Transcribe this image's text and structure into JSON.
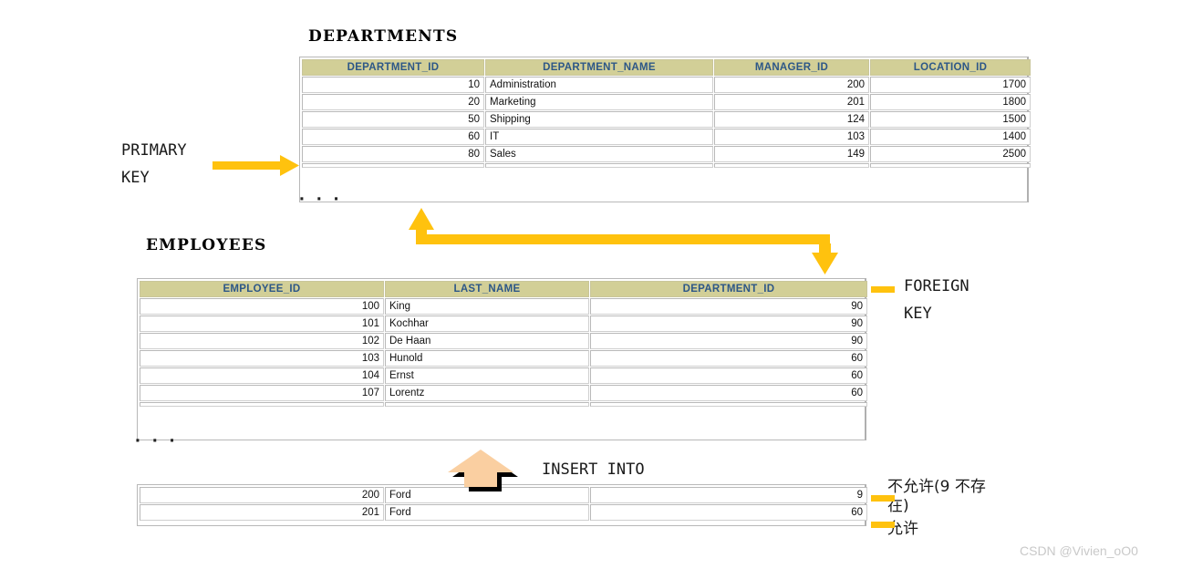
{
  "diagram": {
    "watermark": "CSDN @Vivien_oO0"
  },
  "departments": {
    "title": "DEPARTMENTS",
    "columns": [
      "DEPARTMENT_ID",
      "DEPARTMENT_NAME",
      "MANAGER_ID",
      "LOCATION_ID"
    ],
    "rows": [
      [
        "10",
        "Administration",
        "200",
        "1700"
      ],
      [
        "20",
        "Marketing",
        "201",
        "1800"
      ],
      [
        "50",
        "Shipping",
        "124",
        "1500"
      ],
      [
        "60",
        "IT",
        "103",
        "1400"
      ],
      [
        "80",
        "Sales",
        "149",
        "2500"
      ]
    ],
    "ellipsis": "· · ·"
  },
  "employees": {
    "title": "EMPLOYEES",
    "columns": [
      "EMPLOYEE_ID",
      "LAST_NAME",
      "DEPARTMENT_ID"
    ],
    "rows": [
      [
        "100",
        "King",
        "90"
      ],
      [
        "101",
        "Kochhar",
        "90"
      ],
      [
        "102",
        "De Haan",
        "90"
      ],
      [
        "103",
        "Hunold",
        "60"
      ],
      [
        "104",
        "Ernst",
        "60"
      ],
      [
        "107",
        "Lorentz",
        "60"
      ]
    ],
    "ellipsis": "· · ·"
  },
  "insert_rows": {
    "rows": [
      [
        "200",
        "Ford",
        "9"
      ],
      [
        "201",
        "Ford",
        "60"
      ]
    ]
  },
  "annotations": {
    "primary_key": "PRIMARY\nKEY",
    "foreign_key": "FOREIGN\nKEY",
    "insert_into": "INSERT INTO",
    "not_allowed": "不允许(9 不存在)",
    "allowed": "允许"
  },
  "colors": {
    "header_fill": "#d2cf97",
    "header_text": "#2d5787",
    "arrow_yellow": "#ffc20e",
    "arrow_peach": "#facfa1",
    "grid_border": "#b8b8b8",
    "watermark_text": "#c9c9c9"
  }
}
